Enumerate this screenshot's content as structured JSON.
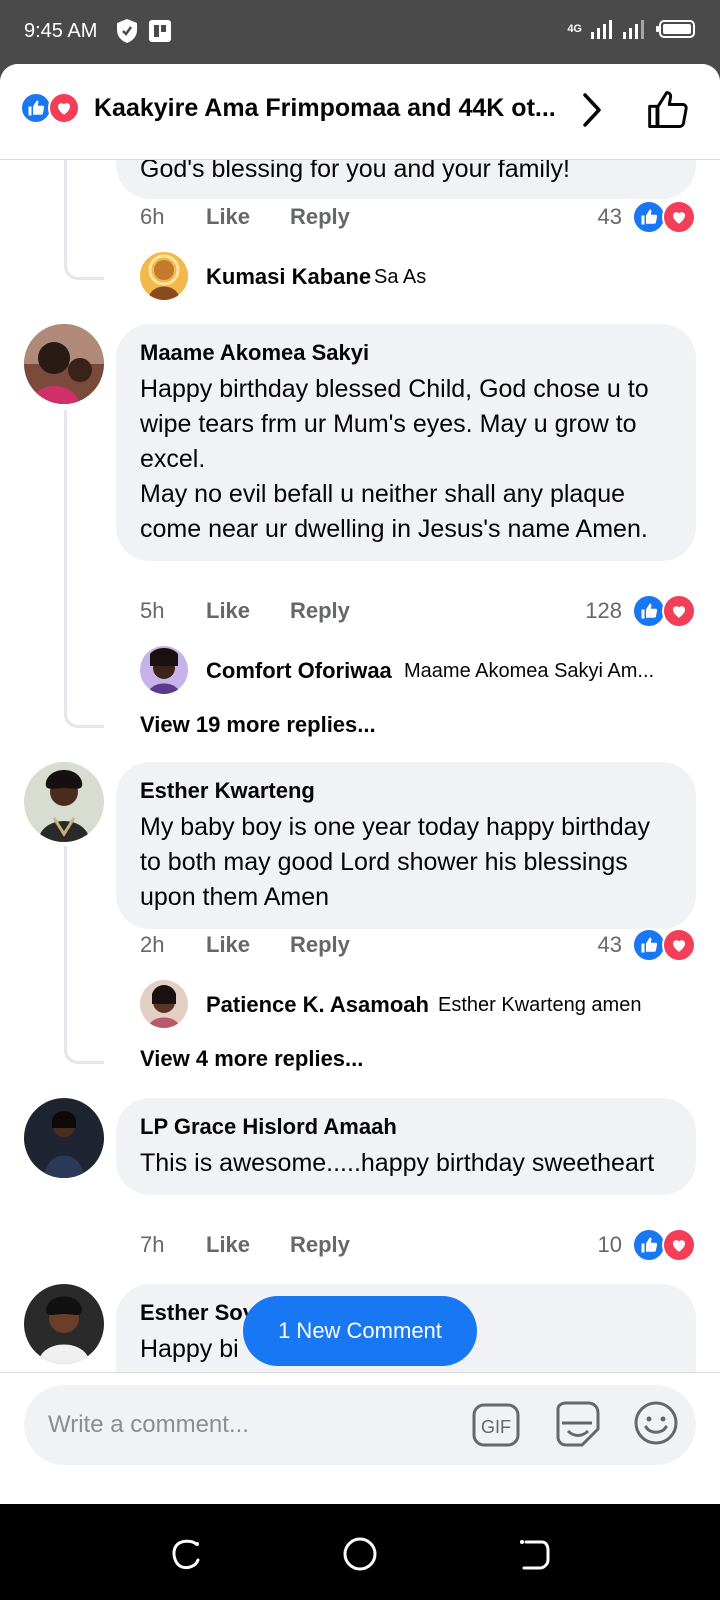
{
  "status_bar": {
    "time": "9:45 AM",
    "network": "4G"
  },
  "header": {
    "title": "Kaakyire Ama Frimpomaa and 44K ot...",
    "icons": [
      "like-reaction-icon",
      "love-reaction-icon",
      "chevron-right-icon",
      "thumbs-up-icon"
    ]
  },
  "comments": [
    {
      "text": "God's blessing for you and your family!",
      "time": "6h",
      "like_label": "Like",
      "reply_label": "Reply",
      "reaction_count": "43",
      "reply_preview": {
        "author": "Kumasi Kabane",
        "text": "Sa As"
      }
    },
    {
      "author": "Maame Akomea Sakyi",
      "text": "Happy birthday blessed Child, God chose u to wipe tears frm ur Mum's eyes. May u grow to excel.\nMay no evil befall u neither shall any plaque come near ur dwelling in Jesus's name Amen.",
      "time": "5h",
      "like_label": "Like",
      "reply_label": "Reply",
      "reaction_count": "128",
      "reply_preview": {
        "author": "Comfort Oforiwaa",
        "text": "Maame Akomea Sakyi Am..."
      },
      "view_more": "View 19 more replies..."
    },
    {
      "author": "Esther Kwarteng",
      "text": "My baby boy is one year today happy birthday to both may good Lord shower his blessings upon them Amen",
      "time": "2h",
      "like_label": "Like",
      "reply_label": "Reply",
      "reaction_count": "43",
      "reply_preview": {
        "author": "Patience K. Asamoah",
        "text": "Esther Kwarteng amen"
      },
      "view_more": "View 4 more replies..."
    },
    {
      "author": "LP Grace Hislord Amaah",
      "text": "This is awesome.....happy birthday sweetheart",
      "time": "7h",
      "like_label": "Like",
      "reply_label": "Reply",
      "reaction_count": "10"
    },
    {
      "author": "Esther Soy",
      "text": "Happy bi"
    }
  ],
  "new_comment_pill": "1 New Comment",
  "composer": {
    "placeholder": "Write a comment...",
    "gif_label": "GIF"
  },
  "colors": {
    "accent": "#1877f2",
    "love": "#f33e58",
    "bubble": "#f0f2f5",
    "meta_text": "#65676b"
  }
}
